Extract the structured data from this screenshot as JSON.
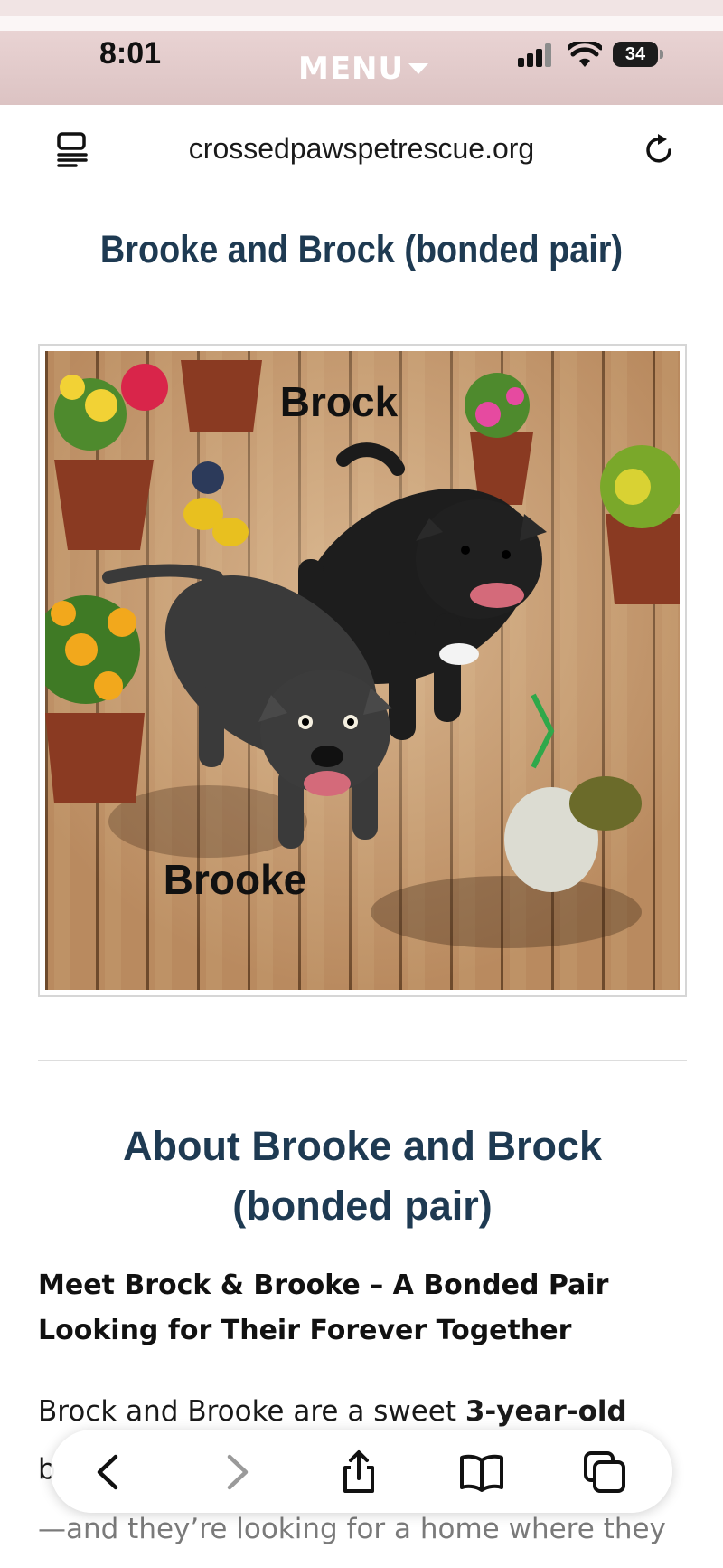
{
  "status_bar": {
    "time": "8:01",
    "menu_label": "MENU",
    "battery": "34"
  },
  "url_bar": {
    "url": "crossedpawspetrescue.org"
  },
  "page": {
    "title": "Brooke and Brock (bonded pair)",
    "photo": {
      "label_top": "Brock",
      "label_bottom": "Brooke"
    },
    "about_heading": "About Brooke and Brock (bonded pair)",
    "meet_heading": "Meet Brock & Brooke – A Bonded Pair Looking for Their Forever Together",
    "intro_text": "Brock and Brooke are a sweet ",
    "intro_bold": "3-year-old",
    "intro_cont": "b",
    "bottom_line": "—and they’re looking for a home where they"
  },
  "toolbar": {
    "icons": [
      "back-icon",
      "forward-icon",
      "share-icon",
      "bookmarks-icon",
      "tabs-icon"
    ]
  },
  "colors": {
    "heading": "#1e3a52",
    "status_bar": "#e2cccc"
  }
}
